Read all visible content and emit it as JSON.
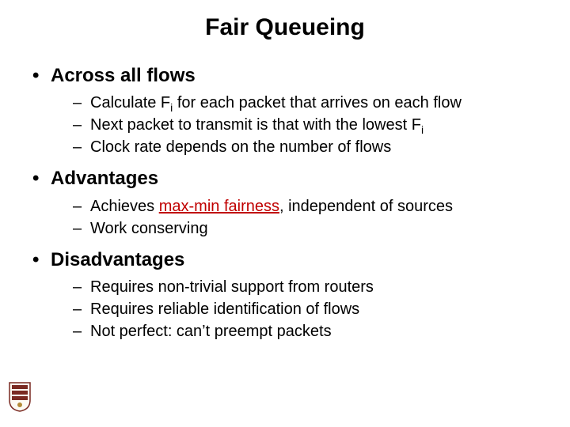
{
  "title": "Fair Queueing",
  "sections": [
    {
      "heading": "Across all flows",
      "items": [
        {
          "prefix": "Calculate F",
          "sub1": "i",
          "mid1": " for each packet that arrives on each flow"
        },
        {
          "prefix": "Next packet to transmit is that with the lowest F",
          "sub1": "i",
          "mid1": ""
        },
        {
          "prefix": "Clock rate depends on the number of flows"
        }
      ]
    },
    {
      "heading": "Advantages",
      "items": [
        {
          "prefix": "Achieves ",
          "hl": "max-min fairness",
          "suffix": ", independent of sources"
        },
        {
          "prefix": "Work conserving"
        }
      ]
    },
    {
      "heading": "Disadvantages",
      "items": [
        {
          "prefix": "Requires non-trivial support from routers"
        },
        {
          "prefix": "Requires reliable identification of flows"
        },
        {
          "prefix": "Not perfect: can’t preempt packets"
        }
      ]
    }
  ]
}
